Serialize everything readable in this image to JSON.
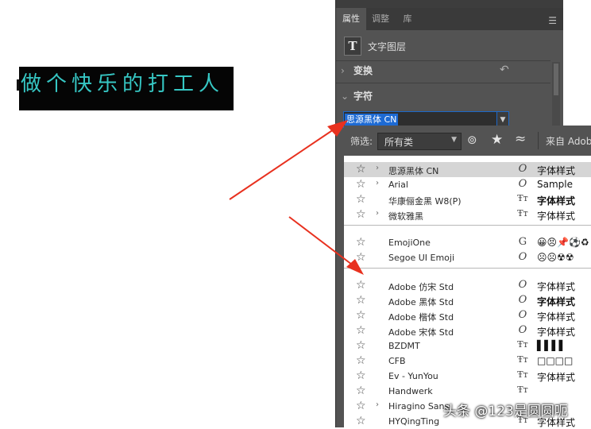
{
  "canvas": {
    "text": "做个快乐的打工人"
  },
  "panel": {
    "tabs": [
      "属性",
      "调整",
      "库"
    ],
    "layer_label": "文字图层",
    "sections": {
      "transform": "变换",
      "character": "字符"
    },
    "font_value": "思源黑体 CN"
  },
  "popup": {
    "filter_label": "筛选:",
    "filter_value": "所有类",
    "from_label": "来自 Adob",
    "rows": [
      {
        "name": "思源黑体 CN",
        "type": "O",
        "sample": "字体样式",
        "expand": true,
        "selected": true
      },
      {
        "name": "Arial",
        "type": "O",
        "sample": "Sample",
        "expand": true
      },
      {
        "name": "华康俪金黑 W8(P)",
        "type": "TT",
        "sample": "字体样式"
      },
      {
        "name": "微软雅黑",
        "type": "TT",
        "sample": "字体样式",
        "expand": true
      },
      {
        "name": "EmojiOne",
        "type": "SVG",
        "sample": "😀😣📌⚽♻"
      },
      {
        "name": "Segoe UI Emoji",
        "type": "O",
        "sample": "☹☹☢☢"
      },
      {
        "name": "Adobe 仿宋 Std",
        "type": "O",
        "sample": "字体样式"
      },
      {
        "name": "Adobe 黑体 Std",
        "type": "O",
        "sample": "字体样式"
      },
      {
        "name": "Adobe 楷体 Std",
        "type": "O",
        "sample": "字体样式"
      },
      {
        "name": "Adobe 宋体 Std",
        "type": "O",
        "sample": "字体样式"
      },
      {
        "name": "BZDMT",
        "type": "TT",
        "sample": "▌▌▌▌"
      },
      {
        "name": "CFB",
        "type": "TT",
        "sample": "□□□□"
      },
      {
        "name": "Ev - YunYou",
        "type": "TT",
        "sample": "字体样式"
      },
      {
        "name": "Handwerk",
        "type": "TT",
        "sample": ""
      },
      {
        "name": "Hiragino Sans",
        "type": "",
        "sample": "",
        "expand": true
      },
      {
        "name": "HYQingTing",
        "type": "TT",
        "sample": "字体样式"
      }
    ]
  },
  "watermark": "头条 @123是圆圆呃",
  "colors": {
    "arrow": "#e8311f",
    "selection": "#1d6ad3",
    "canvas_text": "#36c7c4"
  }
}
